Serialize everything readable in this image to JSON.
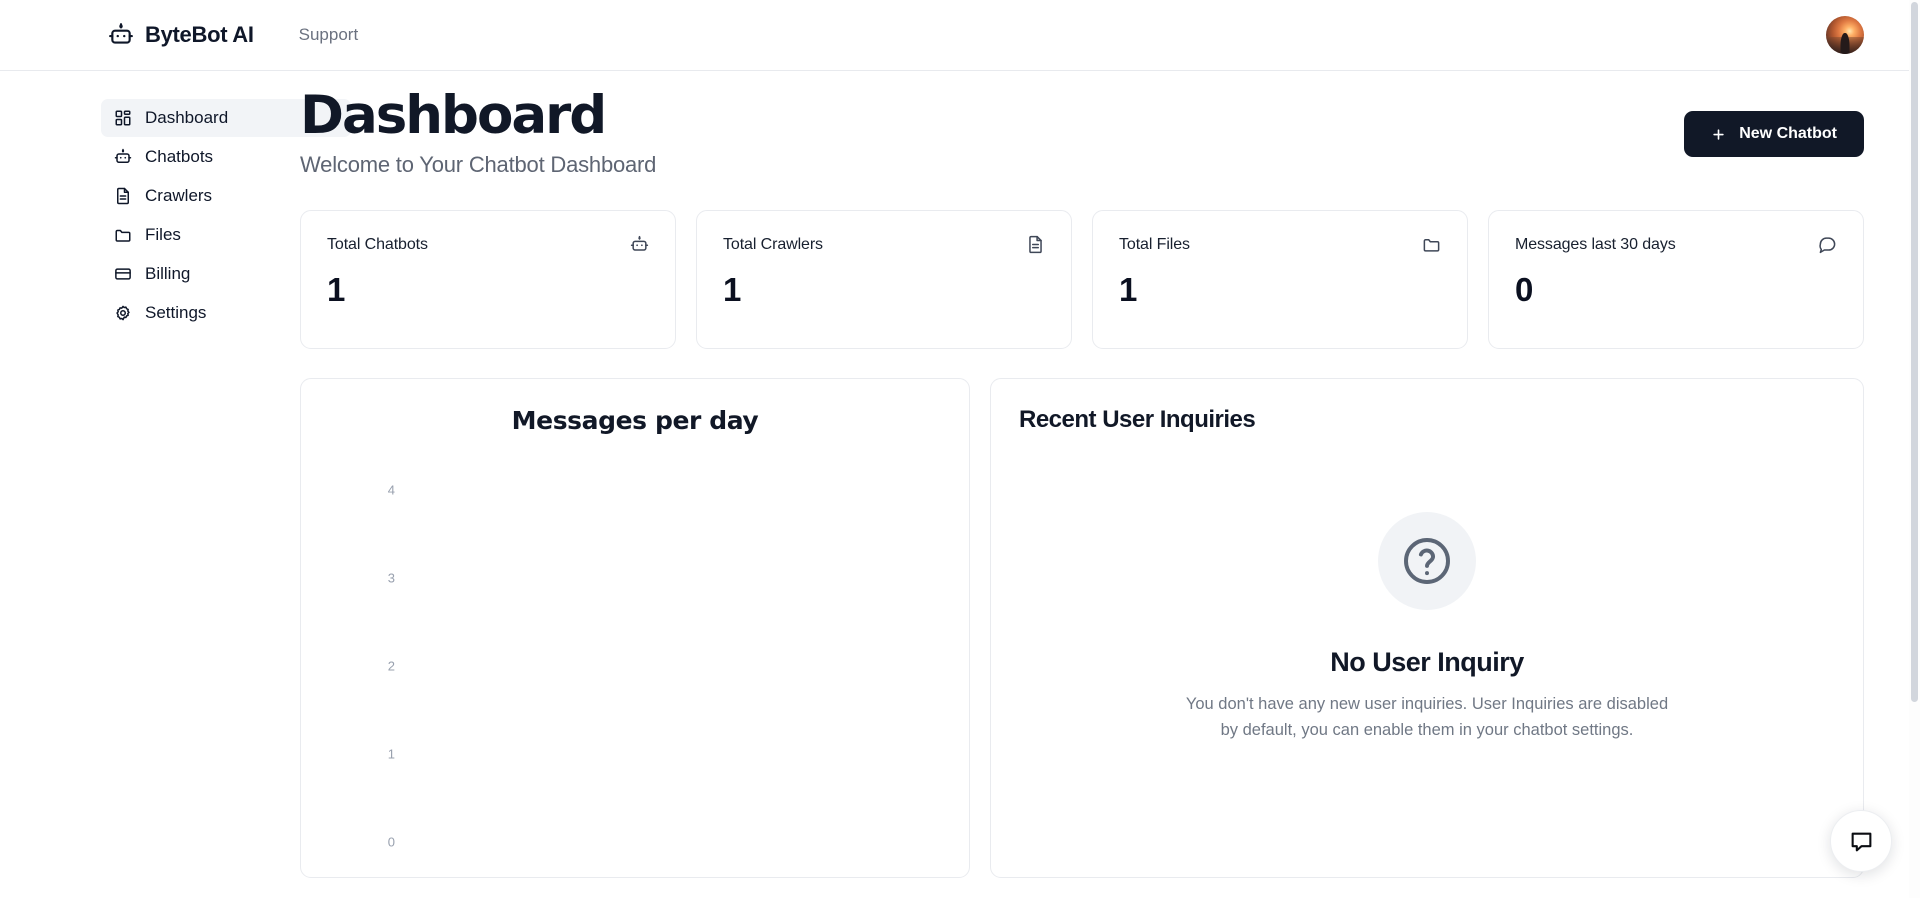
{
  "topbar": {
    "brand_icon": "bot-icon",
    "brand_name": "ByteBot AI",
    "nav": [
      {
        "label": "Support",
        "icon": "none"
      }
    ],
    "avatar_name": "user-avatar"
  },
  "sidebar": {
    "items": [
      {
        "label": "Dashboard",
        "icon": "layout-dashboard-icon",
        "active": true
      },
      {
        "label": "Chatbots",
        "icon": "bot-icon",
        "active": false
      },
      {
        "label": "Crawlers",
        "icon": "file-text-icon",
        "active": false
      },
      {
        "label": "Files",
        "icon": "folder-icon",
        "active": false
      },
      {
        "label": "Billing",
        "icon": "credit-card-icon",
        "active": false
      },
      {
        "label": "Settings",
        "icon": "gear-icon",
        "active": false
      }
    ]
  },
  "page": {
    "title": "Dashboard",
    "subtitle": "Welcome to Your Chatbot Dashboard",
    "new_chatbot_button": "New Chatbot",
    "new_chatbot_icon": "plus-icon",
    "accent_dark": "#111827"
  },
  "stats": [
    {
      "label": "Total Chatbots",
      "value": "1",
      "icon": "bot-icon"
    },
    {
      "label": "Total Crawlers",
      "value": "1",
      "icon": "file-text-icon"
    },
    {
      "label": "Total Files",
      "value": "1",
      "icon": "folder-icon"
    },
    {
      "label": "Messages last 30 days",
      "value": "0",
      "icon": "message-square-icon"
    }
  ],
  "chart_panel": {
    "title": "Messages per day"
  },
  "chart_data": {
    "type": "bar",
    "title": "Messages per day",
    "xlabel": "",
    "ylabel": "",
    "categories": [],
    "values": [],
    "yticks": [
      "4",
      "3",
      "2",
      "1",
      "0"
    ],
    "ylim": [
      0,
      4
    ],
    "grid": false,
    "legend": "none",
    "note": "No data series rendered; empty chart with y-axis ticks only"
  },
  "inquiries_panel": {
    "title": "Recent User Inquiries",
    "empty_icon": "question-circle-icon",
    "empty_title": "No User Inquiry",
    "empty_text": "You don't have any new user inquiries. User Inquiries are disabled by default, you can enable them in your chatbot settings."
  },
  "chat_widget": {
    "icon": "message-square-icon"
  }
}
